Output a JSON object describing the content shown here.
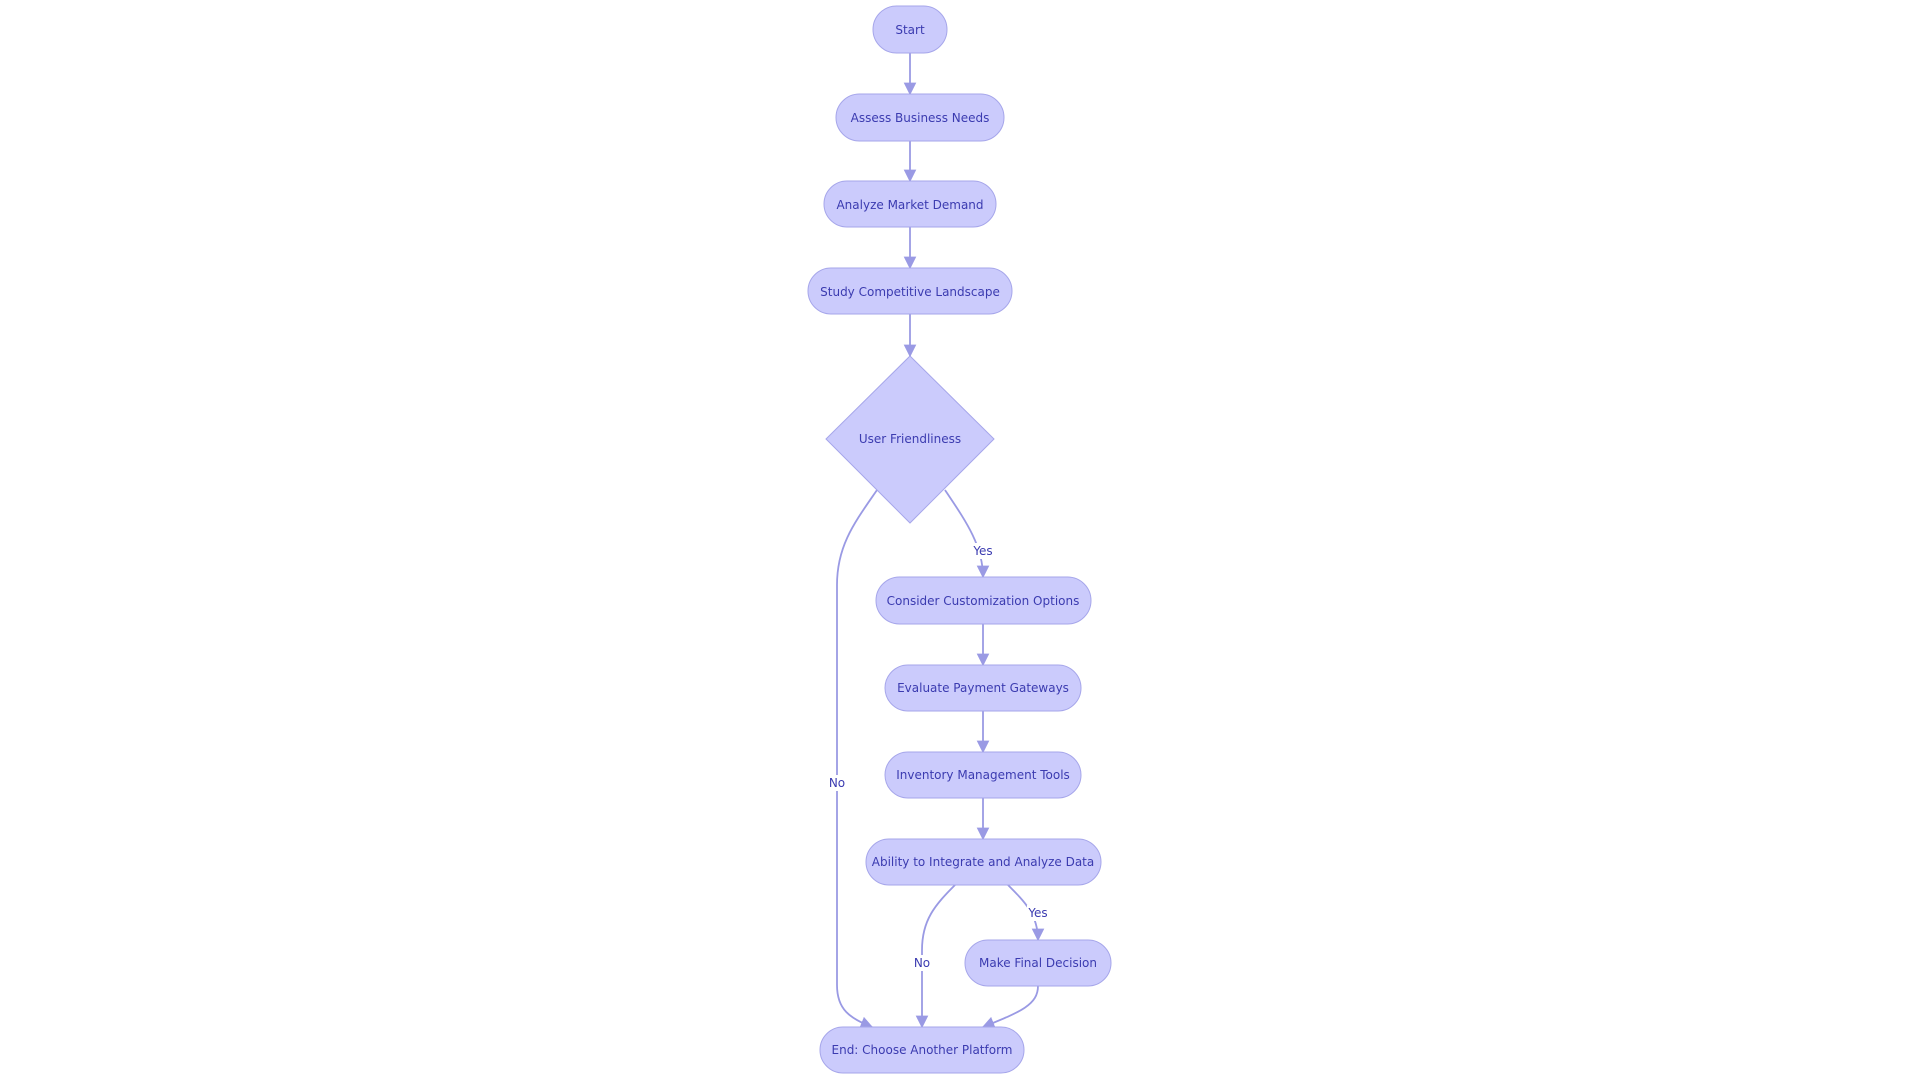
{
  "diagram": {
    "type": "flowchart",
    "direction": "top-down",
    "colors": {
      "node_fill": "#cbcbfc",
      "node_stroke": "#a6a6ea",
      "text": "#3b3bb0",
      "edge": "#9a9ae4"
    },
    "nodes": [
      {
        "id": "start",
        "label": "Start",
        "shape": "stadium"
      },
      {
        "id": "assess",
        "label": "Assess Business Needs",
        "shape": "stadium"
      },
      {
        "id": "analyze",
        "label": "Analyze Market Demand",
        "shape": "stadium"
      },
      {
        "id": "study",
        "label": "Study Competitive Landscape",
        "shape": "stadium"
      },
      {
        "id": "user",
        "label": "User Friendliness",
        "shape": "diamond"
      },
      {
        "id": "custom",
        "label": "Consider Customization Options",
        "shape": "stadium"
      },
      {
        "id": "payment",
        "label": "Evaluate Payment Gateways",
        "shape": "stadium"
      },
      {
        "id": "inventory",
        "label": "Inventory Management Tools",
        "shape": "stadium"
      },
      {
        "id": "ability",
        "label": "Ability to Integrate and Analyze Data",
        "shape": "stadium"
      },
      {
        "id": "final",
        "label": "Make Final Decision",
        "shape": "stadium"
      },
      {
        "id": "end",
        "label": "End: Choose Another Platform",
        "shape": "stadium"
      }
    ],
    "edges": [
      {
        "from": "start",
        "to": "assess",
        "label": ""
      },
      {
        "from": "assess",
        "to": "analyze",
        "label": ""
      },
      {
        "from": "analyze",
        "to": "study",
        "label": ""
      },
      {
        "from": "study",
        "to": "user",
        "label": ""
      },
      {
        "from": "user",
        "to": "custom",
        "label": "Yes"
      },
      {
        "from": "user",
        "to": "end",
        "label": "No"
      },
      {
        "from": "custom",
        "to": "payment",
        "label": ""
      },
      {
        "from": "payment",
        "to": "inventory",
        "label": ""
      },
      {
        "from": "inventory",
        "to": "ability",
        "label": ""
      },
      {
        "from": "ability",
        "to": "final",
        "label": "Yes"
      },
      {
        "from": "ability",
        "to": "end",
        "label": "No"
      },
      {
        "from": "final",
        "to": "end",
        "label": ""
      }
    ]
  }
}
